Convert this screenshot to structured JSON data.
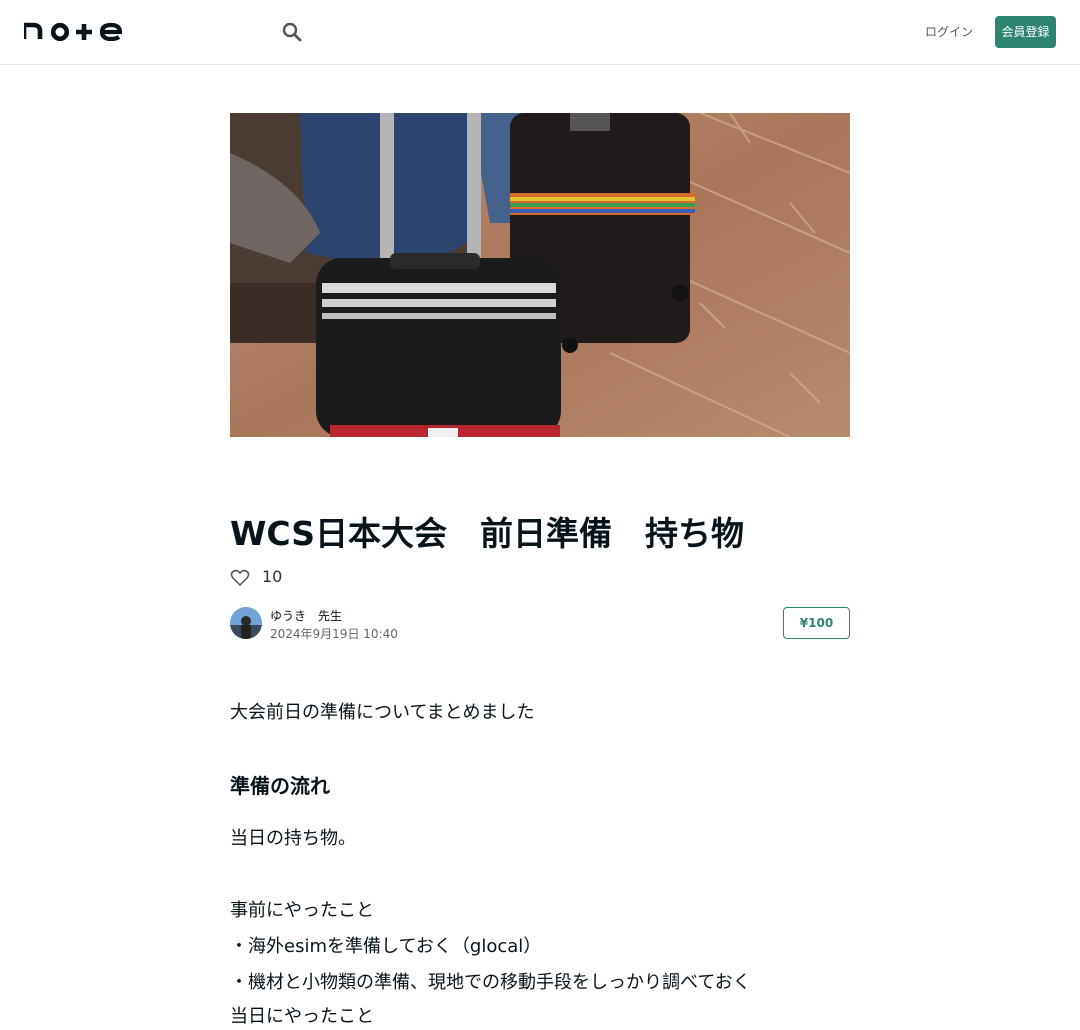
{
  "header": {
    "logo": "note",
    "login": "ログイン",
    "signup": "会員登録"
  },
  "article": {
    "title": "WCS日本大会　前日準備　持ち物",
    "likes": "10",
    "author": "ゆうき　先生",
    "date": "2024年9月19日 10:40",
    "price": "¥100",
    "intro": "大会前日の準備についてまとめました",
    "section_heading": "準備の流れ",
    "paragraph1": "当日の持ち物。",
    "paragraph2": "事前にやったこと",
    "bullet1": "・海外esimを準備しておく（glocal）",
    "bullet2": "・機材と小物類の準備、現地での移動手段をしっかり調べておく",
    "paragraph3": "当日にやったこと"
  },
  "colors": {
    "accent": "#2b8571",
    "text": "#08131a"
  }
}
